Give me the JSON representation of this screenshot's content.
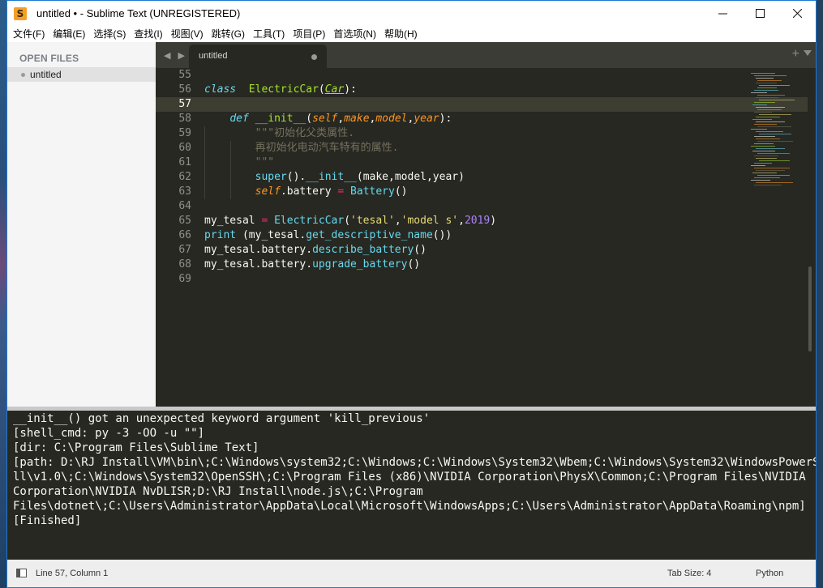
{
  "window": {
    "title": "untitled • - Sublime Text (UNREGISTERED)",
    "app_icon_letter": "S"
  },
  "menu": [
    "文件(F)",
    "编辑(E)",
    "选择(S)",
    "查找(I)",
    "视图(V)",
    "跳转(G)",
    "工具(T)",
    "项目(P)",
    "首选项(N)",
    "帮助(H)"
  ],
  "sidebar": {
    "title": "OPEN FILES",
    "files": [
      "untitled"
    ]
  },
  "tab": {
    "label": "untitled",
    "nav_arrows": "◀ ▶",
    "plus": "+"
  },
  "editor": {
    "current_line": 57,
    "lines": [
      {
        "n": 55,
        "parts": []
      },
      {
        "n": 56,
        "parts": [
          [
            "kw",
            "class"
          ],
          [
            "",
            "  "
          ],
          [
            "cls",
            "ElectricCar"
          ],
          [
            "",
            "("
          ],
          [
            "inh",
            "Car"
          ],
          [
            "",
            "):"
          ]
        ]
      },
      {
        "n": 57,
        "parts": []
      },
      {
        "n": 58,
        "parts": [
          [
            "",
            "    "
          ],
          [
            "kw",
            "def"
          ],
          [
            "",
            " "
          ],
          [
            "fn",
            "__init__"
          ],
          [
            "",
            "("
          ],
          [
            "param",
            "self"
          ],
          [
            "",
            ","
          ],
          [
            "param",
            "make"
          ],
          [
            "",
            ","
          ],
          [
            "param",
            "model"
          ],
          [
            "",
            ","
          ],
          [
            "param",
            "year"
          ],
          [
            "",
            "):"
          ]
        ]
      },
      {
        "n": 59,
        "parts": [
          [
            "",
            "        "
          ],
          [
            "cmt",
            "\"\"\"初始化父类属性."
          ]
        ]
      },
      {
        "n": 60,
        "parts": [
          [
            "",
            "        "
          ],
          [
            "cmt",
            "再初始化电动汽车特有的属性."
          ]
        ]
      },
      {
        "n": 61,
        "parts": [
          [
            "",
            "        "
          ],
          [
            "cmt",
            "\"\"\""
          ]
        ]
      },
      {
        "n": 62,
        "parts": [
          [
            "",
            "        "
          ],
          [
            "call",
            "super"
          ],
          [
            "",
            "()."
          ],
          [
            "call",
            "__init__"
          ],
          [
            "",
            "(make,model,year)"
          ]
        ]
      },
      {
        "n": 63,
        "parts": [
          [
            "",
            "        "
          ],
          [
            "self",
            "self"
          ],
          [
            "",
            ".battery "
          ],
          [
            "op",
            "="
          ],
          [
            "",
            " "
          ],
          [
            "call",
            "Battery"
          ],
          [
            "",
            "()"
          ]
        ]
      },
      {
        "n": 64,
        "parts": []
      },
      {
        "n": 65,
        "parts": [
          [
            "",
            "my_tesal "
          ],
          [
            "op",
            "="
          ],
          [
            "",
            " "
          ],
          [
            "call",
            "ElectricCar"
          ],
          [
            "",
            "("
          ],
          [
            "str",
            "'tesal'"
          ],
          [
            "",
            ","
          ],
          [
            "str",
            "'model s'"
          ],
          [
            "",
            ","
          ],
          [
            "num",
            "2019"
          ],
          [
            "",
            ")"
          ]
        ]
      },
      {
        "n": 66,
        "parts": [
          [
            "call",
            "print"
          ],
          [
            "",
            " (my_tesal."
          ],
          [
            "call",
            "get_descriptive_name"
          ],
          [
            "",
            "())"
          ]
        ]
      },
      {
        "n": 67,
        "parts": [
          [
            "",
            "my_tesal.battery."
          ],
          [
            "call",
            "describe_battery"
          ],
          [
            "",
            "()"
          ]
        ]
      },
      {
        "n": 68,
        "parts": [
          [
            "",
            "my_tesal.battery."
          ],
          [
            "call",
            "upgrade_battery"
          ],
          [
            "",
            "()"
          ]
        ]
      },
      {
        "n": 69,
        "parts": []
      }
    ]
  },
  "output": {
    "lines": [
      "__init__() got an unexpected keyword argument 'kill_previous'",
      "[shell_cmd: py -3 -OO -u \"\"]",
      "[dir: C:\\Program Files\\Sublime Text]",
      "[path: D:\\RJ Install\\VM\\bin\\;C:\\Windows\\system32;C:\\Windows;C:\\Windows\\System32\\Wbem;C:\\Windows\\System32\\WindowsPowerShe",
      "ll\\v1.0\\;C:\\Windows\\System32\\OpenSSH\\;C:\\Program Files (x86)\\NVIDIA Corporation\\PhysX\\Common;C:\\Program Files\\NVIDIA",
      "Corporation\\NVIDIA NvDLISR;D:\\RJ Install\\node.js\\;C:\\Program",
      "Files\\dotnet\\;C:\\Users\\Administrator\\AppData\\Local\\Microsoft\\WindowsApps;C:\\Users\\Administrator\\AppData\\Roaming\\npm]",
      "[Finished]"
    ]
  },
  "status": {
    "position": "Line 57, Column 1",
    "tab_size": "Tab Size: 4",
    "syntax": "Python"
  },
  "colors": {
    "editor_bg": "#272822",
    "keyword": "#66d9ef",
    "class_name": "#a6e22e",
    "param": "#fd971f",
    "operator": "#f92672",
    "string": "#e6db74",
    "number": "#ae81ff",
    "comment": "#75715e"
  }
}
